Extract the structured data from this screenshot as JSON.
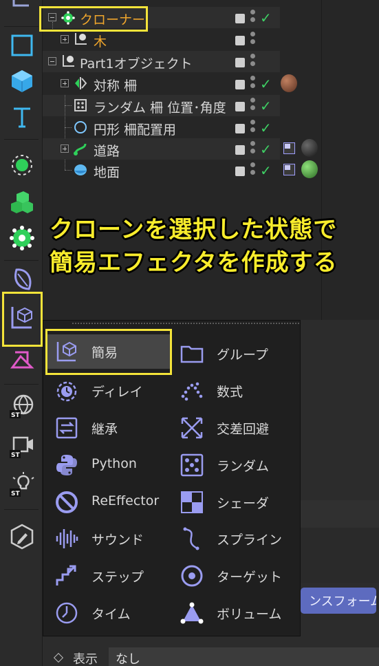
{
  "objects": [
    {
      "name": "クローナー",
      "indent": 0,
      "tree": "minus",
      "icon": "cloner-icon",
      "color": "#f0a62c",
      "check": true,
      "material": null
    },
    {
      "name": "木",
      "indent": 1,
      "tree": "plus",
      "icon": "null-object-icon",
      "color": "#f0a62c",
      "check": false,
      "material": null
    },
    {
      "name": "Part1オブジェクト",
      "indent": 0,
      "tree": "minus",
      "icon": "null-object-icon",
      "color": "#d6d6d6",
      "check": false,
      "material": null
    },
    {
      "name": "対称 柵",
      "indent": 1,
      "tree": "plus",
      "icon": "symmetry-icon",
      "color": "#d6d6d6",
      "check": true,
      "material": "#8a5a3c"
    },
    {
      "name": "ランダム 柵 位置･角度",
      "indent": 1,
      "tree": "none",
      "icon": "random-icon",
      "color": "#d6d6d6",
      "check": true,
      "material": null
    },
    {
      "name": "円形 柵配置用",
      "indent": 1,
      "tree": "none",
      "icon": "circle-spline-icon",
      "color": "#d6d6d6",
      "check": true,
      "material": null
    },
    {
      "name": "道路",
      "indent": 1,
      "tree": "plus",
      "icon": "sweep-icon",
      "color": "#d6d6d6",
      "check": true,
      "material": "#2e2e2e",
      "tag": true
    },
    {
      "name": "地面",
      "indent": 1,
      "tree": "none",
      "icon": "plane-icon",
      "color": "#d6d6d6",
      "check": true,
      "material": "#4c8a3a",
      "tag": true
    }
  ],
  "instruction": {
    "line1": "クローンを選択した状態で",
    "line2": "簡易エフェクタを作成する"
  },
  "menu": {
    "left": [
      {
        "label": "簡易",
        "icon": "plain-effector-icon",
        "active": true
      },
      {
        "label": "ディレイ",
        "icon": "delay-effector-icon"
      },
      {
        "label": "継承",
        "icon": "inheritance-effector-icon"
      },
      {
        "label": "Python",
        "icon": "python-effector-icon"
      },
      {
        "label": "ReEffector",
        "icon": "reeffector-icon"
      },
      {
        "label": "サウンド",
        "icon": "sound-effector-icon"
      },
      {
        "label": "ステップ",
        "icon": "step-effector-icon"
      },
      {
        "label": "タイム",
        "icon": "time-effector-icon"
      }
    ],
    "right": [
      {
        "label": "グループ",
        "icon": "group-effector-icon"
      },
      {
        "label": "数式",
        "icon": "formula-effector-icon"
      },
      {
        "label": "交差回避",
        "icon": "push-apart-effector-icon"
      },
      {
        "label": "ランダム",
        "icon": "random-effector-icon"
      },
      {
        "label": "シェーダ",
        "icon": "shader-effector-icon"
      },
      {
        "label": "スプライン",
        "icon": "spline-effector-icon"
      },
      {
        "label": "ターゲット",
        "icon": "target-effector-icon"
      },
      {
        "label": "ボリューム",
        "icon": "volume-effector-icon"
      }
    ]
  },
  "attributes": {
    "transform_button": "ンスフォーム",
    "display_label": "表示",
    "display_value": "なし"
  },
  "colors": {
    "highlight": "#f4e43a",
    "accent": "#9a9cf0",
    "check": "#3ecf64"
  }
}
